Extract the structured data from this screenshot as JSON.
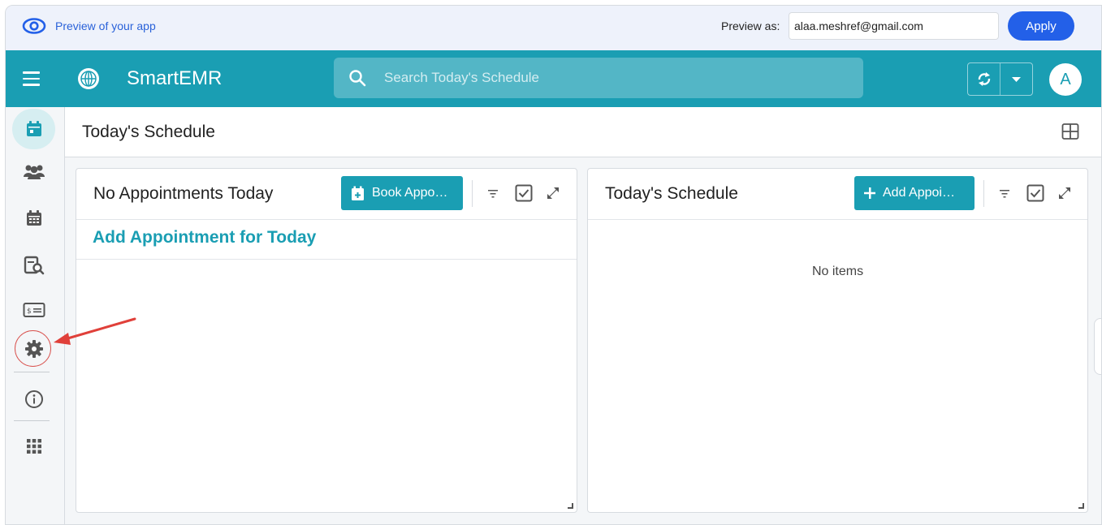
{
  "preview_bar": {
    "text": "Preview of your app",
    "preview_as_label": "Preview as:",
    "preview_as_value": "alaa.meshref@gmail.com",
    "apply_label": "Apply"
  },
  "app_bar": {
    "title": "SmartEMR",
    "search_placeholder": "Search Today's Schedule",
    "avatar_initial": "A"
  },
  "sidebar": {
    "items": [
      {
        "icon": "calendar-today-icon",
        "active": true
      },
      {
        "icon": "users-icon",
        "active": false
      },
      {
        "icon": "calendar-grid-icon",
        "active": false
      },
      {
        "icon": "record-search-icon",
        "active": false
      },
      {
        "icon": "billing-icon",
        "active": false
      },
      {
        "icon": "gear-icon",
        "active": false,
        "highlighted": true
      },
      {
        "icon": "info-icon",
        "active": false
      },
      {
        "icon": "apps-grid-icon",
        "active": false
      }
    ]
  },
  "page": {
    "title": "Today's Schedule"
  },
  "left_panel": {
    "title": "No Appointments Today",
    "button_label": "Book Appo…",
    "link_label": "Add Appointment for Today"
  },
  "right_panel": {
    "title": "Today's Schedule",
    "button_label": "Add Appoi…",
    "empty_text": "No items"
  },
  "colors": {
    "teal": "#1a9eb3",
    "apply_blue": "#2360e8",
    "annotation_red": "#d9534f"
  }
}
